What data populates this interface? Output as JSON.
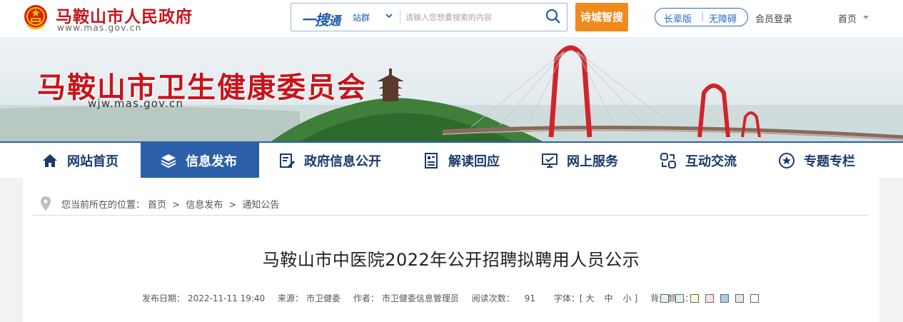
{
  "header": {
    "site_name": "马鞍山市人民政府",
    "site_url": "www.mas.gov.cn",
    "search": {
      "brand_main": "一搜",
      "brand_tail": "通",
      "scope": "站群",
      "placeholder": "请输入您想要搜索的内容"
    },
    "poem_button": "诗城智搜",
    "elder_mode": "长辈版",
    "separator": "|",
    "accessibility": "无障碍",
    "login": "会员登录",
    "home": "首页"
  },
  "banner": {
    "title": "马鞍山市卫生健康委员会",
    "url": "wjw.mas.gov.cn"
  },
  "nav": {
    "items": [
      {
        "label": "网站首页",
        "icon": "home-icon"
      },
      {
        "label": "信息发布",
        "icon": "layers-icon",
        "active": true
      },
      {
        "label": "政府信息公开",
        "icon": "document-edit-icon"
      },
      {
        "label": "解读回应",
        "icon": "book-icon"
      },
      {
        "label": "网上服务",
        "icon": "monitor-icon"
      },
      {
        "label": "互动交流",
        "icon": "link-icon"
      },
      {
        "label": "专题专栏",
        "icon": "star-circle-icon"
      }
    ]
  },
  "breadcrumb": {
    "prefix": "您当前所在的位置：",
    "items": [
      "首页",
      "信息发布",
      "通知公告"
    ],
    "separator": ">"
  },
  "article": {
    "title": "马鞍山市中医院2022年公开招聘拟聘用人员公示",
    "meta": {
      "date_label": "发布日期：",
      "date": "2022-11-11 19:40",
      "source_label": "来源：",
      "source": "市卫健委",
      "author_label": "作者：",
      "author": "市卫健委信息管理员",
      "views_label": "阅读次数：",
      "views": "91",
      "font_label": "字体：[",
      "font_large": "大",
      "font_medium": "中",
      "font_small": "小",
      "font_close": "]",
      "bg_label": "背景颜色："
    },
    "bg_colors": [
      "#e3f0f7",
      "#dff6f4",
      "#fffbd8",
      "#fbe1f2",
      "#a9cde8",
      "#e6e6e6",
      "#ffffff"
    ]
  },
  "colors": {
    "brand_red": "#c5161d",
    "nav_blue": "#2b5faa",
    "accent_orange": "#f08a1c"
  }
}
